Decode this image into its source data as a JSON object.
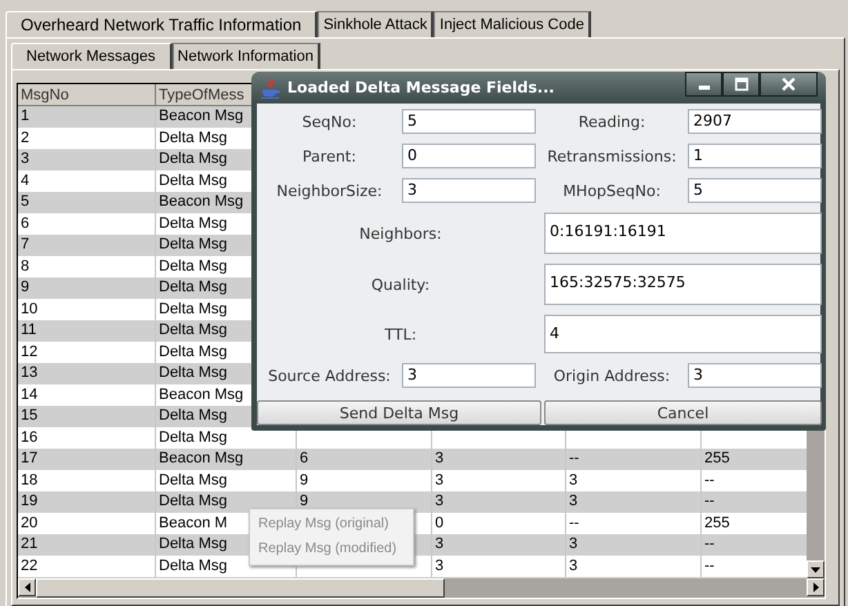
{
  "outer_tabs": [
    {
      "label": "Overheard Network Traffic Information",
      "selected": true
    },
    {
      "label": "Sinkhole Attack",
      "selected": false
    },
    {
      "label": "Inject Malicious Code",
      "selected": false
    }
  ],
  "inner_tabs": [
    {
      "label": "Network Messages",
      "selected": true
    },
    {
      "label": "Network Information",
      "selected": false
    }
  ],
  "table": {
    "columns": [
      "MsgNo",
      "TypeOfMess"
    ],
    "rows": [
      {
        "msg_no": "1",
        "type": "Beacon Msg"
      },
      {
        "msg_no": "2",
        "type": "Delta Msg"
      },
      {
        "msg_no": "3",
        "type": "Delta Msg"
      },
      {
        "msg_no": "4",
        "type": "Delta Msg"
      },
      {
        "msg_no": "5",
        "type": "Beacon Msg"
      },
      {
        "msg_no": "6",
        "type": "Delta Msg"
      },
      {
        "msg_no": "7",
        "type": "Delta Msg"
      },
      {
        "msg_no": "8",
        "type": "Delta Msg"
      },
      {
        "msg_no": "9",
        "type": "Delta Msg"
      },
      {
        "msg_no": "10",
        "type": "Delta Msg"
      },
      {
        "msg_no": "11",
        "type": "Delta Msg"
      },
      {
        "msg_no": "12",
        "type": "Delta Msg"
      },
      {
        "msg_no": "13",
        "type": "Delta Msg"
      },
      {
        "msg_no": "14",
        "type": "Beacon Msg"
      },
      {
        "msg_no": "15",
        "type": "Delta Msg"
      },
      {
        "msg_no": "16",
        "type": "Delta Msg"
      },
      {
        "msg_no": "17",
        "type": "Beacon Msg",
        "column_3": "6",
        "column_4": "3",
        "column_5": "--",
        "column_6": "255"
      },
      {
        "msg_no": "18",
        "type": "Delta Msg",
        "column_3": "9",
        "column_4": "3",
        "column_5": "3",
        "column_6": "--"
      },
      {
        "msg_no": "19",
        "type": "Delta Msg",
        "column_3": "9",
        "column_4": "3",
        "column_5": "3",
        "column_6": "--"
      },
      {
        "msg_no": "20",
        "type": "Beacon M",
        "column_4": "0",
        "column_5": "--",
        "column_6": "255"
      },
      {
        "msg_no": "21",
        "type": "Delta Msg",
        "column_4": "3",
        "column_5": "3",
        "column_6": "--"
      },
      {
        "msg_no": "22",
        "type": "Delta Msg",
        "column_4": "3",
        "column_5": "3",
        "column_6": "--"
      }
    ]
  },
  "dialog": {
    "title": "Loaded Delta Message Fields...",
    "rows": [
      {
        "kind": "pair",
        "fields": [
          {
            "label": "SeqNo:",
            "value": "5"
          },
          {
            "label": "Reading:",
            "value": "2907"
          }
        ]
      },
      {
        "kind": "pair",
        "fields": [
          {
            "label": "Parent:",
            "value": "0"
          },
          {
            "label": "Retransmissions:",
            "value": "1"
          }
        ]
      },
      {
        "kind": "pair",
        "fields": [
          {
            "label": "NeighborSize:",
            "value": "3"
          },
          {
            "label": "MHopSeqNo:",
            "value": "5"
          }
        ]
      },
      {
        "kind": "wide",
        "label": "Neighbors:",
        "value": "0:16191:16191"
      },
      {
        "kind": "wide",
        "label": "Quality:",
        "value": "165:32575:32575"
      },
      {
        "kind": "wide",
        "label": "TTL:",
        "value": "4"
      },
      {
        "kind": "pair",
        "fields": [
          {
            "label": "Source Address:",
            "value": "3"
          },
          {
            "label": "Origin Address:",
            "value": "3"
          }
        ]
      }
    ],
    "buttons": [
      "Send Delta Msg",
      "Cancel"
    ]
  },
  "context_menu": [
    {
      "label": "Replay Msg (original)",
      "disabled": true
    },
    {
      "label": "Replay Msg (modified)",
      "disabled": true
    }
  ]
}
